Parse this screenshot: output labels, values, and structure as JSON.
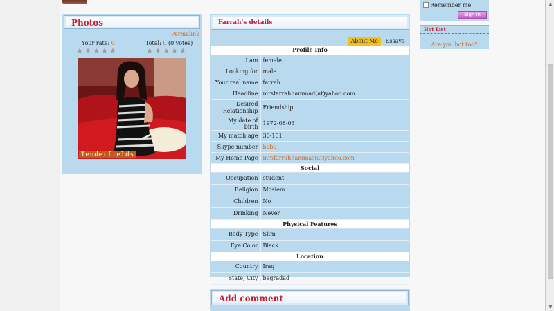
{
  "photos_panel": {
    "title": "Photos",
    "permalink": "Permalink",
    "your_rate_label": "Your rate:",
    "your_rate_value": "0",
    "total_label": "Total:",
    "total_value": "0",
    "votes_text": "(0 votes)",
    "star_glyph": "★",
    "star_count": 5,
    "photo_watermark": "Tenderfields"
  },
  "details_panel": {
    "title": "Farrah's details",
    "tabs": [
      {
        "label": "About Me",
        "active": true
      },
      {
        "label": "Essays",
        "active": false
      }
    ],
    "sections": [
      {
        "title": "Profile Info",
        "rows": [
          {
            "label": "I am",
            "value": "female"
          },
          {
            "label": "Looking for",
            "value": "male"
          },
          {
            "label": "Your real name",
            "value": "farrah"
          },
          {
            "label": "Headline",
            "value": "mrsfarrahhammad(at)yahoo.com"
          },
          {
            "label": "Desired Relationship",
            "value": "Friendship"
          },
          {
            "label": "My date of birth",
            "value": "1972-08-03"
          },
          {
            "label": "My match age",
            "value": "30-101"
          },
          {
            "label": "Skype number",
            "value": "babu",
            "link": true
          },
          {
            "label": "My Home Page",
            "value": "mrsfarrahhammas(at)yahoo.com",
            "link": true
          }
        ]
      },
      {
        "title": "Social",
        "rows": [
          {
            "label": "Occupation",
            "value": "student"
          },
          {
            "label": "Religion",
            "value": "Moslem"
          },
          {
            "label": "Children",
            "value": "No"
          },
          {
            "label": "Drinking",
            "value": "Never"
          }
        ]
      },
      {
        "title": "Physical Features",
        "rows": [
          {
            "label": "Body Type",
            "value": "Slim"
          },
          {
            "label": "Eye Color",
            "value": "Black"
          }
        ]
      },
      {
        "title": "Location",
        "rows": [
          {
            "label": "Country",
            "value": "Iraq"
          },
          {
            "label": "State, City",
            "value": "bagradad"
          }
        ]
      }
    ]
  },
  "comment_panel": {
    "title": "Add comment"
  },
  "login_box": {
    "remember_label": "Remember me",
    "signin_label": "Sign in"
  },
  "hot_list": {
    "title": "Hot List",
    "link": "Are you hot too?"
  },
  "colors": {
    "panel_bg": "#b9d9ef",
    "title_red": "#c0203a",
    "link_orange": "#d2691e",
    "tab_active": "#f0c020"
  }
}
